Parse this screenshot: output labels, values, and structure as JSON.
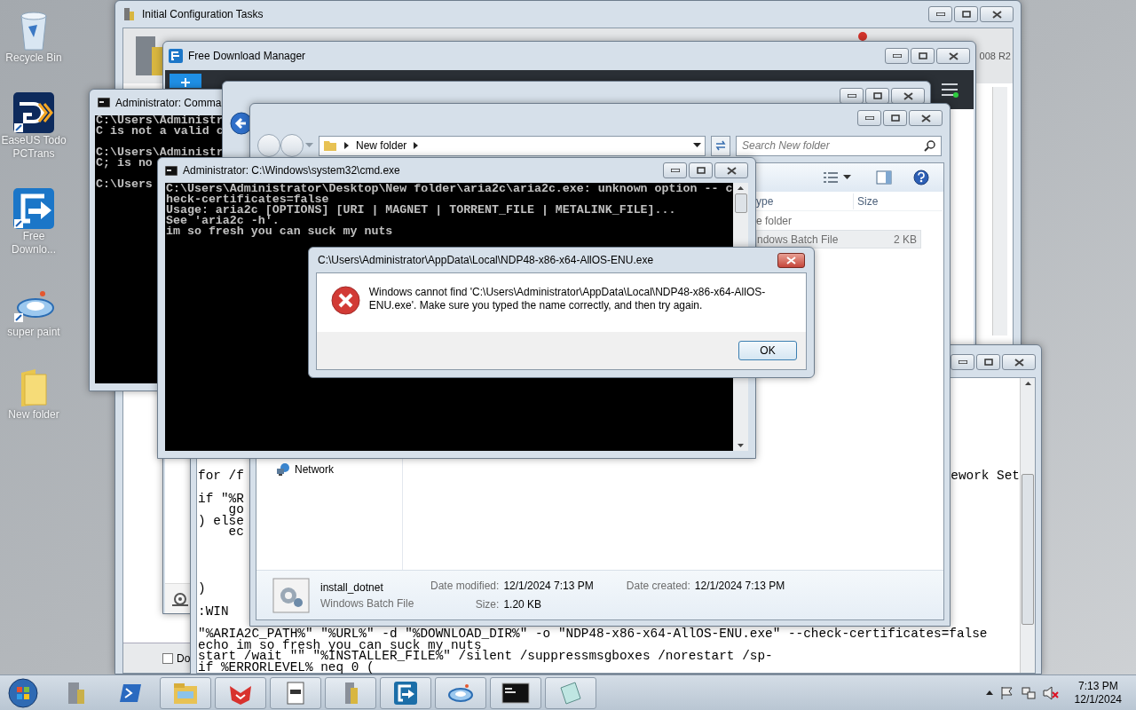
{
  "desktop_icons": [
    {
      "kind": "recycle",
      "label": "Recycle Bin"
    },
    {
      "kind": "easeus",
      "label": "EaseUS Todo PCTrans"
    },
    {
      "kind": "fdm",
      "label": "Free Downlo..."
    },
    {
      "kind": "paint",
      "label": "super paint"
    },
    {
      "kind": "folder",
      "label": "New folder"
    }
  ],
  "config_window": {
    "title": "Initial Configuration Tasks",
    "edition_text": "008 R2",
    "checkbox_label": "Do",
    "checked": false
  },
  "fdm_window": {
    "title": "Free Download Manager"
  },
  "notepad": {
    "first_line": {
      "start": "for /f",
      "end": "ework Set"
    },
    "upper_lines": [
      "if \"%R",
      "    go",
      ") else",
      "    ec"
    ],
    "lower_blocks": [
      [
        ")"
      ],
      [
        ":WIN"
      ],
      [
        "\"%ARIA2C_PATH%\" \"%URL%\" -d \"%DOWNLOAD_DIR%\" -o \"NDP48-x86-x64-AllOS-ENU.exe\" --check-certificates=false",
        "echo im so fresh you can suck my nuts",
        "start /wait \"\" \"%INSTALLER_FILE%\" /silent /suppressmsgboxes /norestart /sp-",
        "if %ERRORLEVEL% neq 0 ("
      ]
    ]
  },
  "cmd_back": {
    "title": "Administrator: Comma",
    "blocks": [
      [
        "C:\\Users\\Administr",
        "C is not a valid c"
      ],
      [
        "C:\\Users\\Administr",
        "C; is no"
      ],
      [
        "C:\\Users"
      ]
    ]
  },
  "explorer": {
    "address": "New folder",
    "search_placeholder": "Search New folder",
    "columns": [
      "ype",
      "Size"
    ],
    "rows": [
      {
        "type": "e folder",
        "selected": false
      },
      {
        "type": "ndows Batch File",
        "size": "2 KB",
        "selected": true
      }
    ],
    "nav_items": [
      "Network"
    ],
    "details": {
      "name": "install_dotnet",
      "type": "Windows Batch File",
      "fields": [
        {
          "label": "Date modified:",
          "value": "12/1/2024 7:13 PM"
        },
        {
          "label": "Size:",
          "value": "1.20 KB"
        },
        {
          "label": "Date created:",
          "value": "12/1/2024 7:13 PM"
        }
      ]
    }
  },
  "cmd_front": {
    "title": "Administrator: C:\\Windows\\system32\\cmd.exe",
    "lines": [
      "C:\\Users\\Administrator\\Desktop\\New folder\\aria2c\\aria2c.exe: unknown option -- c",
      "heck-certificates=false",
      "Usage: aria2c [OPTIONS] [URI | MAGNET | TORRENT_FILE | METALINK_FILE]...",
      "See 'aria2c -h'.",
      "im so fresh you can suck my nuts"
    ]
  },
  "dialog": {
    "title": "C:\\Users\\Administrator\\AppData\\Local\\NDP48-x86-x64-AllOS-ENU.exe",
    "message": "Windows cannot find 'C:\\Users\\Administrator\\AppData\\Local\\NDP48-x86-x64-AllOS-ENU.exe'. Make sure you typed the name correctly, and then try again.",
    "button": "OK"
  },
  "taskbar": {
    "items": [
      {
        "kind": "server"
      },
      {
        "kind": "powershell"
      },
      {
        "kind": "explorer"
      },
      {
        "kind": "redapp"
      },
      {
        "kind": "document"
      },
      {
        "kind": "config"
      },
      {
        "kind": "fdm"
      },
      {
        "kind": "paint"
      },
      {
        "kind": "cmd"
      },
      {
        "kind": "tablet"
      }
    ],
    "time": "7:13 PM",
    "date": "12/1/2024"
  }
}
